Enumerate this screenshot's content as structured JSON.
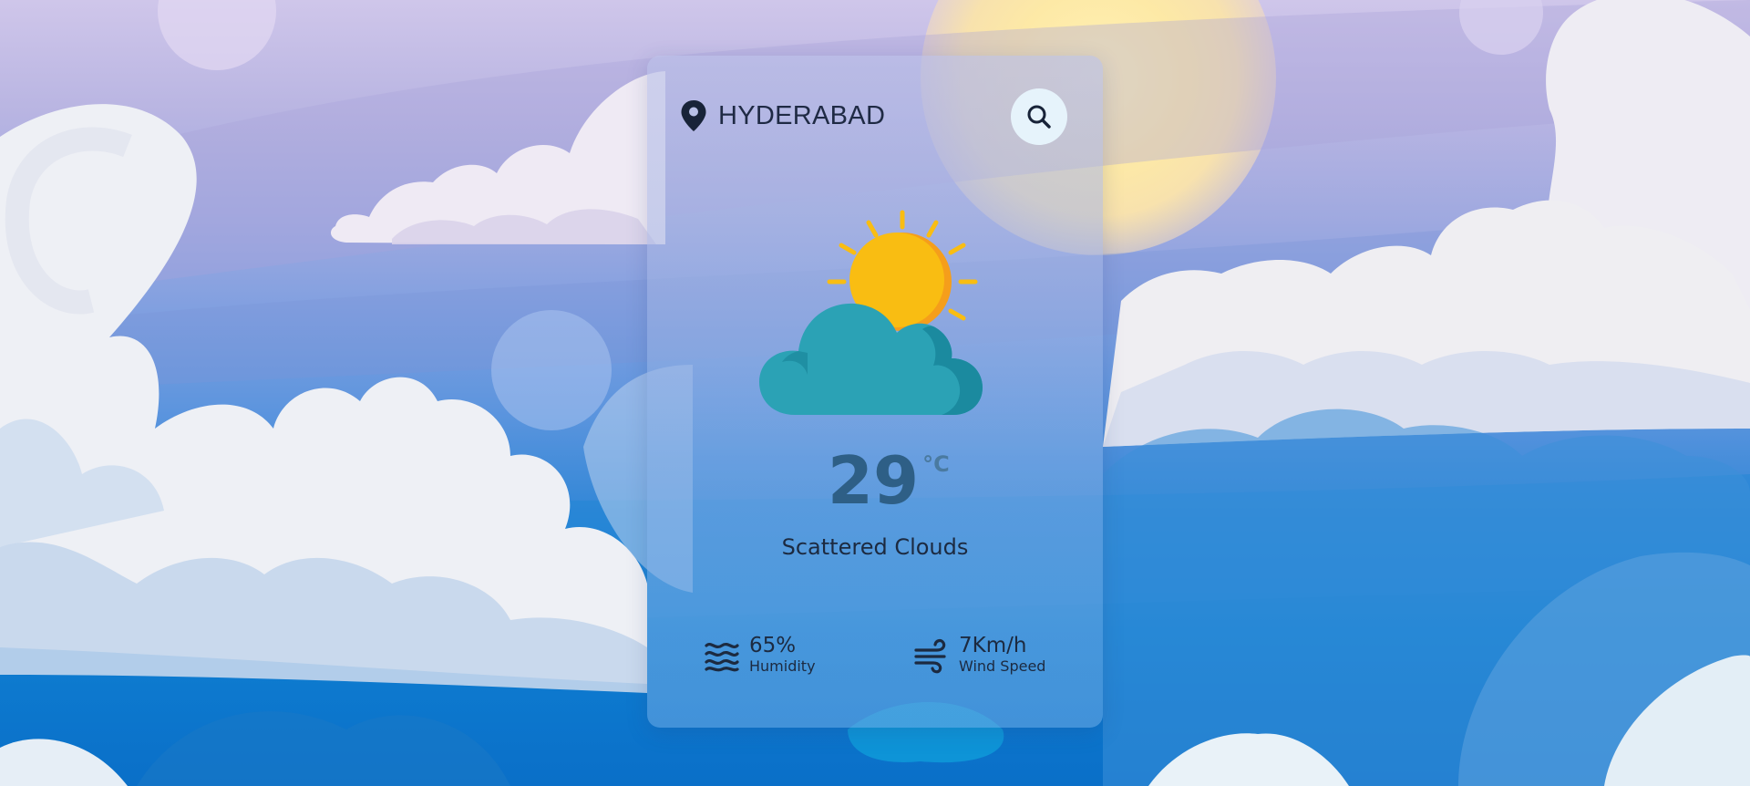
{
  "location": {
    "icon": "map-pin-icon",
    "city": "HYDERABAD"
  },
  "search": {
    "icon": "search-icon"
  },
  "current": {
    "icon": "sun-behind-cloud-icon",
    "temperature": "29",
    "unit": "°C",
    "condition": "Scattered Clouds"
  },
  "stats": {
    "humidity": {
      "icon": "humidity-waves-icon",
      "value": "65%",
      "label": "Humidity"
    },
    "wind": {
      "icon": "wind-icon",
      "value": "7Km/h",
      "label": "Wind Speed"
    }
  },
  "colors": {
    "accent_text": "#1c2a40",
    "temperature": "#2e5f86",
    "sun": "#f9bd12",
    "cloud": "#2ba2b5",
    "search_button_bg": "#e6f3fb"
  }
}
